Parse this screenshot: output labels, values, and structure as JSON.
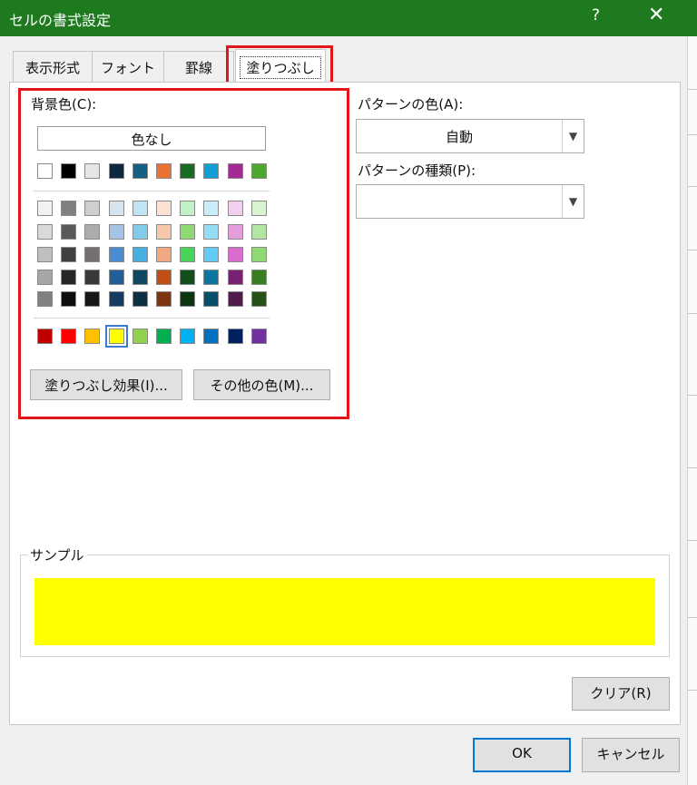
{
  "window": {
    "title": "セルの書式設定",
    "help": "?",
    "close": "✕"
  },
  "tabs": [
    {
      "label": "表示形式"
    },
    {
      "label": "フォント"
    },
    {
      "label": "罫線"
    },
    {
      "label": "塗りつぶし",
      "active": true
    }
  ],
  "background": {
    "label": "背景色(C):",
    "no_color_label": "色なし",
    "theme_row": [
      "#ffffff",
      "#000000",
      "#e7e6e6",
      "#0e2841",
      "#156082",
      "#e97132",
      "#196b24",
      "#0f9ed5",
      "#a02b93",
      "#4ea72e"
    ],
    "shade_rows": [
      [
        "#f2f2f2",
        "#808080",
        "#d0cece",
        "#d6e4f0",
        "#c1e4f5",
        "#fbe2d5",
        "#c2f1c8",
        "#caedfb",
        "#f2cfee",
        "#d9f2d0"
      ],
      [
        "#d9d9d9",
        "#595959",
        "#aeabab",
        "#a5c3e4",
        "#83cbeb",
        "#f7c7ac",
        "#8ed973",
        "#95dcf7",
        "#e49edd",
        "#b4e5a2"
      ],
      [
        "#bfbfbf",
        "#404040",
        "#757070",
        "#4a8bd1",
        "#45b0e1",
        "#f1a983",
        "#47d45a",
        "#61cbf4",
        "#d86dcd",
        "#8ed973"
      ],
      [
        "#a6a6a6",
        "#262626",
        "#3a3838",
        "#215f9a",
        "#104862",
        "#c04f15",
        "#124f1a",
        "#0b76a0",
        "#782170",
        "#3b7d23"
      ],
      [
        "#808080",
        "#0d0d0d",
        "#161616",
        "#153d64",
        "#0a3041",
        "#7f3510",
        "#0c3511",
        "#074e6a",
        "#511b4a",
        "#265018"
      ]
    ],
    "standard_row": [
      "#c00000",
      "#ff0000",
      "#ffc000",
      "#ffff00",
      "#92d050",
      "#00b050",
      "#00b0f0",
      "#0070c0",
      "#002060",
      "#7030a0"
    ],
    "selected_standard_index": 3,
    "fill_effects_button": "塗りつぶし効果(I)...",
    "more_colors_button": "その他の色(M)..."
  },
  "pattern": {
    "color_label": "パターンの色(A):",
    "color_value": "自動",
    "style_label": "パターンの種類(P):",
    "style_value": ""
  },
  "sample": {
    "label": "サンプル",
    "color": "#ffff00"
  },
  "buttons": {
    "clear": "クリア(R)",
    "ok": "OK",
    "cancel": "キャンセル"
  },
  "colors": {
    "titlebar": "#1e7a1e",
    "highlight": "#e0161a"
  }
}
